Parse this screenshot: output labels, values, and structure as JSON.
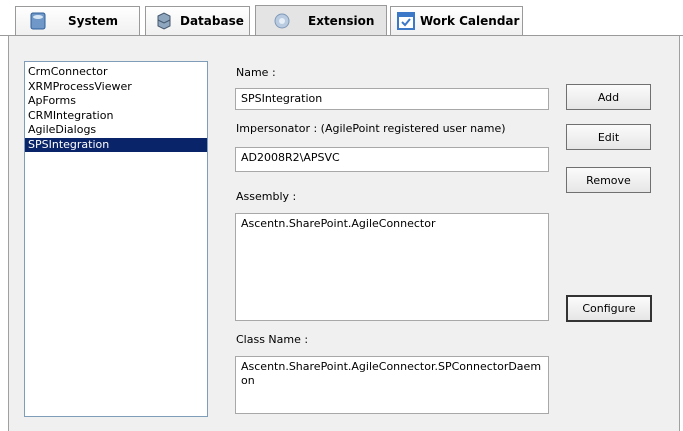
{
  "tabs": [
    {
      "label": "System",
      "icon": "system-icon"
    },
    {
      "label": "Database",
      "icon": "database-icon"
    },
    {
      "label": "Extension",
      "icon": "extension-icon",
      "active": true
    },
    {
      "label": "Work Calendar",
      "icon": "calendar-icon"
    }
  ],
  "extension_list": {
    "items": [
      "CrmConnector",
      "XRMProcessViewer",
      "ApForms",
      "CRMIntegration",
      "AgileDialogs",
      "SPSIntegration"
    ],
    "selected": "SPSIntegration"
  },
  "form": {
    "name_label": "Name :",
    "name_value": "SPSIntegration",
    "impersonator_label": "Impersonator : (AgilePoint registered user name)",
    "impersonator_value": "AD2008R2\\APSVC",
    "assembly_label": "Assembly :",
    "assembly_value": "Ascentn.SharePoint.AgileConnector",
    "classname_label": "Class Name :",
    "classname_value": "Ascentn.SharePoint.AgileConnector.SPConnectorDaem\non"
  },
  "buttons": {
    "add": "Add",
    "edit": "Edit",
    "remove": "Remove",
    "configure": "Configure"
  }
}
